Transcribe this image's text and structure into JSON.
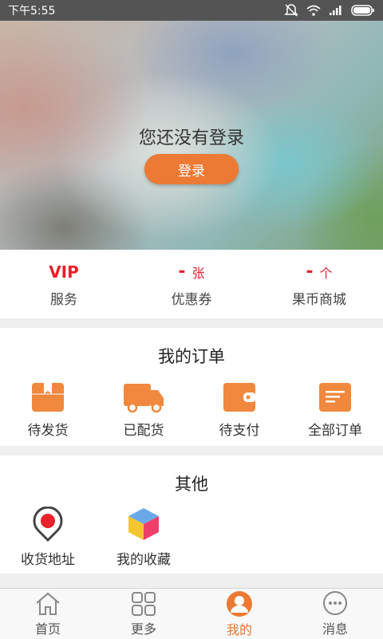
{
  "status_bar": {
    "time": "下午5:55"
  },
  "hero": {
    "title": "您还没有登录",
    "login_label": "登录"
  },
  "stats": [
    {
      "value": "VIP",
      "label": "服务"
    },
    {
      "value": "-",
      "unit": "张",
      "label": "优惠券"
    },
    {
      "value": "-",
      "unit": "个",
      "label": "果币商城"
    }
  ],
  "orders": {
    "title": "我的订单",
    "items": [
      {
        "label": "待发货",
        "icon": "package-icon"
      },
      {
        "label": "已配货",
        "icon": "delivery-truck-icon"
      },
      {
        "label": "待支付",
        "icon": "wallet-icon"
      },
      {
        "label": "全部订单",
        "icon": "order-list-icon"
      }
    ]
  },
  "other": {
    "title": "其他",
    "items": [
      {
        "label": "收货地址",
        "icon": "location-pin-icon"
      },
      {
        "label": "我的收藏",
        "icon": "favorites-cube-icon"
      }
    ]
  },
  "tabbar": {
    "items": [
      {
        "label": "首页",
        "icon": "home-icon"
      },
      {
        "label": "更多",
        "icon": "grid-icon"
      },
      {
        "label": "我的",
        "icon": "user-icon",
        "active": true
      },
      {
        "label": "消息",
        "icon": "message-icon"
      }
    ]
  },
  "colors": {
    "accent": "#ec7a34",
    "vip_red": "#e8212a",
    "icon_orange": "#f0883e"
  }
}
